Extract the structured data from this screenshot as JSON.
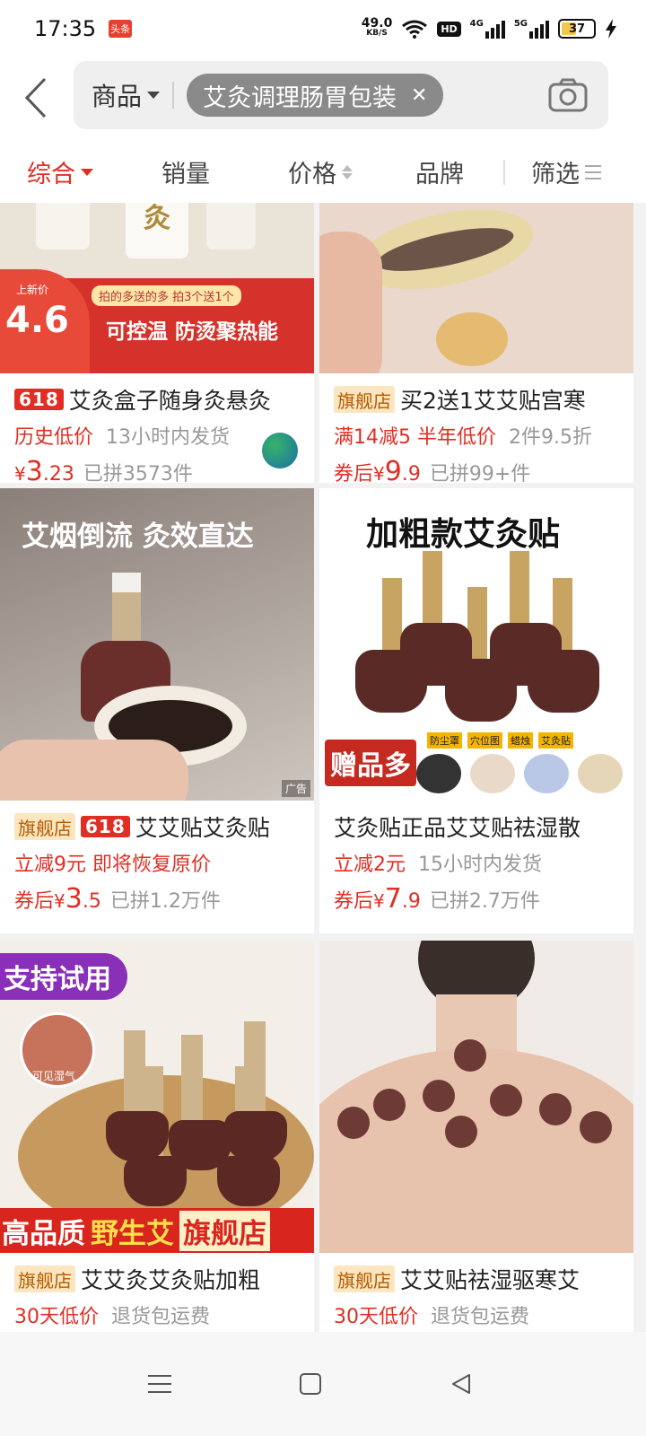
{
  "status": {
    "time": "17:35",
    "app_badge": "头条",
    "net_speed": "49.0",
    "net_unit": "KB/S",
    "hd": "HD",
    "sig1": "4G",
    "sig2": "5G",
    "battery": "37"
  },
  "search": {
    "scope": "商品",
    "query": "艾灸调理肠胃包装"
  },
  "sort": {
    "items": [
      "综合",
      "销量",
      "价格",
      "品牌",
      "筛选"
    ]
  },
  "products": [
    {
      "badge": "618",
      "title": "艾灸盒子随身灸悬灸",
      "promo_red": "历史低价",
      "promo_grey": "13小时内发货",
      "price_prefix": "",
      "price_yen": "¥",
      "price_int": "3",
      "price_dec": ".23",
      "sold": "已拼3573件",
      "img_price_label": "上新价",
      "img_price": "4.6",
      "img_banner": "可控温 防烫聚热能",
      "img_ribbon": "拍的多送的多 拍3个送1个",
      "img_top_char": "灸"
    },
    {
      "shop_tag": "旗舰店",
      "title": "买2送1艾艾贴宫寒",
      "promo_red": "满14减5  半年低价",
      "promo_grey": "2件9.5折",
      "price_prefix": "券后",
      "price_yen": "¥",
      "price_int": "9",
      "price_dec": ".9",
      "sold": "已拼99+件"
    },
    {
      "shop_tag": "旗舰店",
      "badge": "618",
      "title": "艾艾贴艾灸贴",
      "promo_red": "立减9元  即将恢复原价",
      "promo_grey": "",
      "price_prefix": "券后",
      "price_yen": "¥",
      "price_int": "3",
      "price_dec": ".5",
      "sold": "已拼1.2万件",
      "img_headline": "艾烟倒流 灸效直达",
      "ad_label": "广告"
    },
    {
      "title": "艾灸贴正品艾艾贴祛湿散",
      "promo_red": "立减2元",
      "promo_grey": "15小时内发货",
      "price_prefix": "券后",
      "price_yen": "¥",
      "price_int": "7",
      "price_dec": ".9",
      "sold": "已拼2.7万件",
      "img_headline": "加粗款艾灸贴",
      "img_gift": "赠品多",
      "img_gift_items": [
        "防尘罩",
        "穴位图",
        "蜡烛",
        "艾灸贴"
      ]
    },
    {
      "shop_tag": "旗舰店",
      "title": "艾艾灸艾灸贴加粗",
      "promo_red": "30天低价",
      "promo_grey": "退货包运费",
      "img_badge": "支持试用",
      "img_small": "可见湿气",
      "img_banner_a": "高品质",
      "img_banner_b": "野生艾",
      "img_banner_c": "旗舰店"
    },
    {
      "shop_tag": "旗舰店",
      "title": "艾艾贴祛湿驱寒艾",
      "promo_red": "30天低价",
      "promo_grey": "退货包运费"
    }
  ],
  "colors": {
    "accent": "#e02e24",
    "shop_tag_bg": "#fbe6c0"
  }
}
